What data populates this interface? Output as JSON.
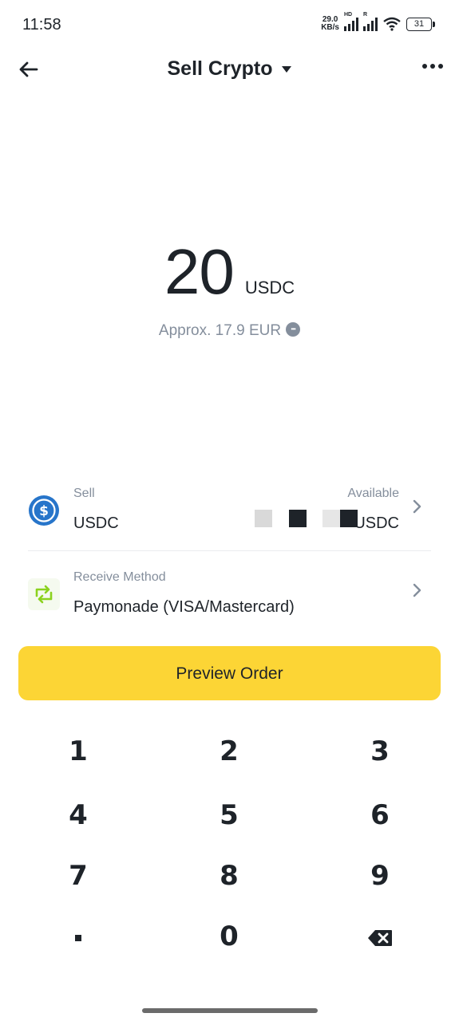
{
  "status_bar": {
    "time": "11:58",
    "net_speed_value": "29.0",
    "net_speed_unit": "KB/s",
    "signal1_tag": "HD",
    "signal2_tag": "R",
    "battery": "31"
  },
  "header": {
    "title": "Sell Crypto",
    "back_icon": "arrow-left-icon",
    "more_icon": "more-horizontal-icon"
  },
  "amount": {
    "value": "20",
    "unit": "USDC",
    "approx": "Approx. 17.9 EUR"
  },
  "sell_row": {
    "label": "Sell",
    "value": "USDC",
    "available_label": "Available",
    "available_value": "USDC"
  },
  "receive_row": {
    "label": "Receive Method",
    "value": "Paymonade (VISA/Mastercard)"
  },
  "preview_button": "Preview Order",
  "keypad": {
    "keys": [
      "1",
      "2",
      "3",
      "4",
      "5",
      "6",
      "7",
      "8",
      "9",
      ".",
      "0",
      "backspace"
    ]
  },
  "colors": {
    "accent": "#fcd535",
    "text": "#1e2329",
    "muted": "#848e9c",
    "usdc_blue": "#2775ca",
    "receive_green": "#8bd21e"
  }
}
